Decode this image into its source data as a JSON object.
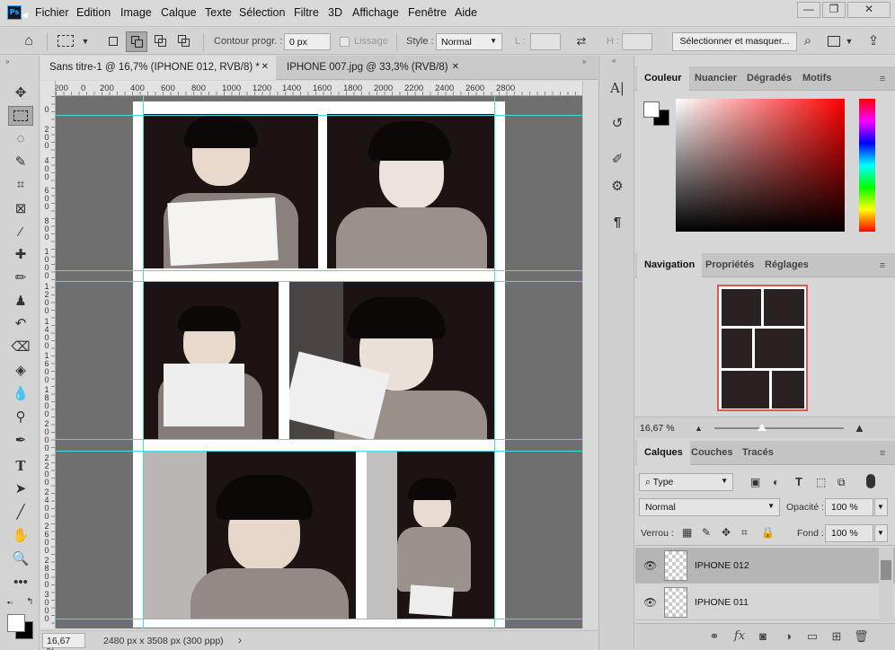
{
  "app": {
    "logo": "Ps"
  },
  "menu": [
    "Fichier",
    "Edition",
    "Image",
    "Calque",
    "Texte",
    "Sélection",
    "Filtre",
    "3D",
    "Affichage",
    "Fenêtre",
    "Aide"
  ],
  "window_controls": {
    "minimize": "—",
    "restore": "❐",
    "close": "✕"
  },
  "options": {
    "feather_label": "Contour progr. :",
    "feather_value": "0 px",
    "antialias_label": "Lissage",
    "style_label": "Style :",
    "style_value": "Normal",
    "width_label": "L :",
    "height_label": "H :",
    "select_mask_button": "Sélectionner et masquer..."
  },
  "tabs": [
    {
      "label": "Sans titre-1 @ 16,7% (IPHONE 012, RVB/8) *",
      "close": "✕"
    },
    {
      "label": "IPHONE 007.jpg @ 33,3% (RVB/8)",
      "close": "✕"
    }
  ],
  "ruler_top": [
    "200",
    "0",
    "200",
    "400",
    "600",
    "800",
    "1000",
    "1200",
    "1400",
    "1600",
    "1800",
    "2000",
    "2200",
    "2400",
    "2600",
    "2800"
  ],
  "ruler_left": [
    "0",
    "2 0 0",
    "4 0 0",
    "6 0 0",
    "8 0 0",
    "1 0 0 0",
    "1 2 0 0",
    "1 4 0 0",
    "1 6 0 0",
    "1 8 0 0",
    "2 0 0 0",
    "2 2 0 0",
    "2 4 0 0",
    "2 6 0 0",
    "2 8 0 0",
    "3 0 0 0",
    "3 2 0 0",
    "3 4 0 0"
  ],
  "status": {
    "zoom": "16,67 %",
    "doc_info": "2480 px x 3508 px (300 ppp)",
    "arrow": "›"
  },
  "color_panel": {
    "tabs": [
      "Couleur",
      "Nuancier",
      "Dégradés",
      "Motifs"
    ],
    "foreground": "#ffffff",
    "background": "#000000"
  },
  "nav_panel": {
    "tabs": [
      "Navigation",
      "Propriétés",
      "Réglages"
    ],
    "zoom": "16,67 %"
  },
  "layers_panel": {
    "tabs": [
      "Calques",
      "Couches",
      "Tracés"
    ],
    "filter_type": "Type",
    "blend_mode": "Normal",
    "opacity_label": "Opacité :",
    "opacity_value": "100 %",
    "lock_label": "Verrou :",
    "fill_label": "Fond :",
    "fill_value": "100 %",
    "layers": [
      {
        "name": "IPHONE 012",
        "selected": true
      },
      {
        "name": "IPHONE 011",
        "selected": false
      }
    ]
  },
  "colors": {
    "guide": "#3ee0e6",
    "nav_frame": "#e05656",
    "accent": "#31a8ff"
  }
}
